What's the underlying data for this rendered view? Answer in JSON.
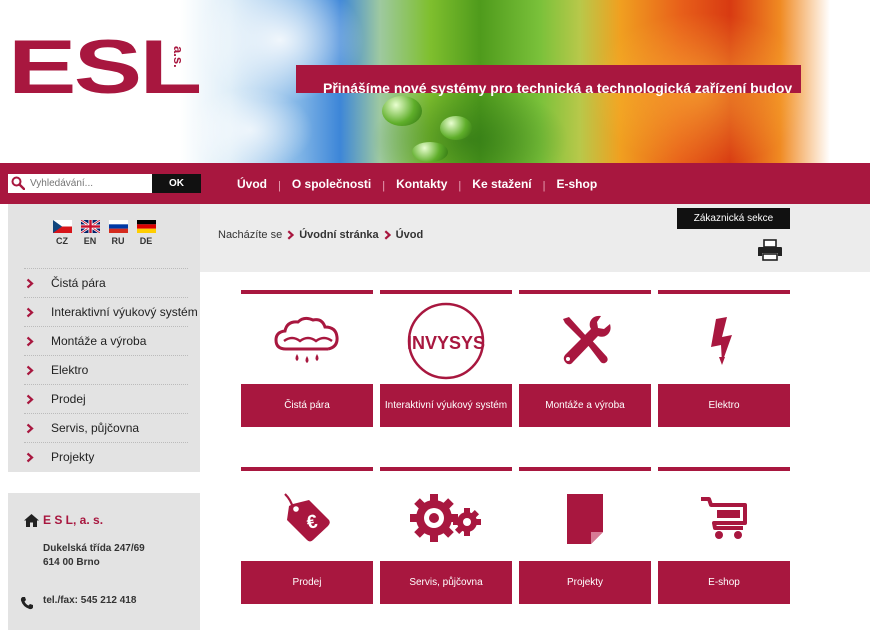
{
  "header": {
    "logo_text": "ESL",
    "logo_suffix": "a.s.",
    "slogan": "Přinášíme nové systémy pro technická a technologická zařízení budov"
  },
  "search": {
    "placeholder": "Vyhledávání...",
    "button_label": "OK",
    "icon": "search-icon"
  },
  "nav": {
    "items": [
      {
        "label": "Úvod"
      },
      {
        "label": "O společnosti"
      },
      {
        "label": "Kontakty"
      },
      {
        "label": "Ke stažení"
      },
      {
        "label": "E-shop"
      }
    ],
    "separator": "|"
  },
  "languages": [
    {
      "code": "CZ"
    },
    {
      "code": "EN"
    },
    {
      "code": "RU"
    },
    {
      "code": "DE"
    }
  ],
  "sidebar": {
    "items": [
      {
        "label": "Čistá pára"
      },
      {
        "label": "Interaktivní výukový systém"
      },
      {
        "label": "Montáže a výroba"
      },
      {
        "label": "Elektro"
      },
      {
        "label": "Prodej"
      },
      {
        "label": "Servis, půjčovna"
      },
      {
        "label": "Projekty"
      }
    ]
  },
  "contact": {
    "company": "E S L, a. s.",
    "address_line1": "Dukelská třída 247/69",
    "address_line2": "614 00 Brno",
    "phone": "tel./fax: 545 212 418"
  },
  "breadcrumb": {
    "prefix": "Nacházíte se",
    "items": [
      "Úvodní stránka",
      "Úvod"
    ]
  },
  "customer_section": "Zákaznická sekce",
  "tiles": [
    {
      "label": "Čistá pára",
      "icon": "steam-cloud-icon"
    },
    {
      "label": "Interaktivní výukový systém",
      "icon": "invysys-logo-icon",
      "icon_text": "INVYSYS"
    },
    {
      "label": "Montáže a výroba",
      "icon": "tools-icon"
    },
    {
      "label": "Elektro",
      "icon": "lightning-icon"
    },
    {
      "label": "Prodej",
      "icon": "price-tag-icon",
      "icon_text": "€"
    },
    {
      "label": "Servis, půjčovna",
      "icon": "gears-icon"
    },
    {
      "label": "Projekty",
      "icon": "document-icon"
    },
    {
      "label": "E-shop",
      "icon": "cart-icon"
    }
  ],
  "colors": {
    "brand": "#a8173f",
    "sidebar_bg": "#e3e3e3",
    "button_dark": "#111111"
  }
}
